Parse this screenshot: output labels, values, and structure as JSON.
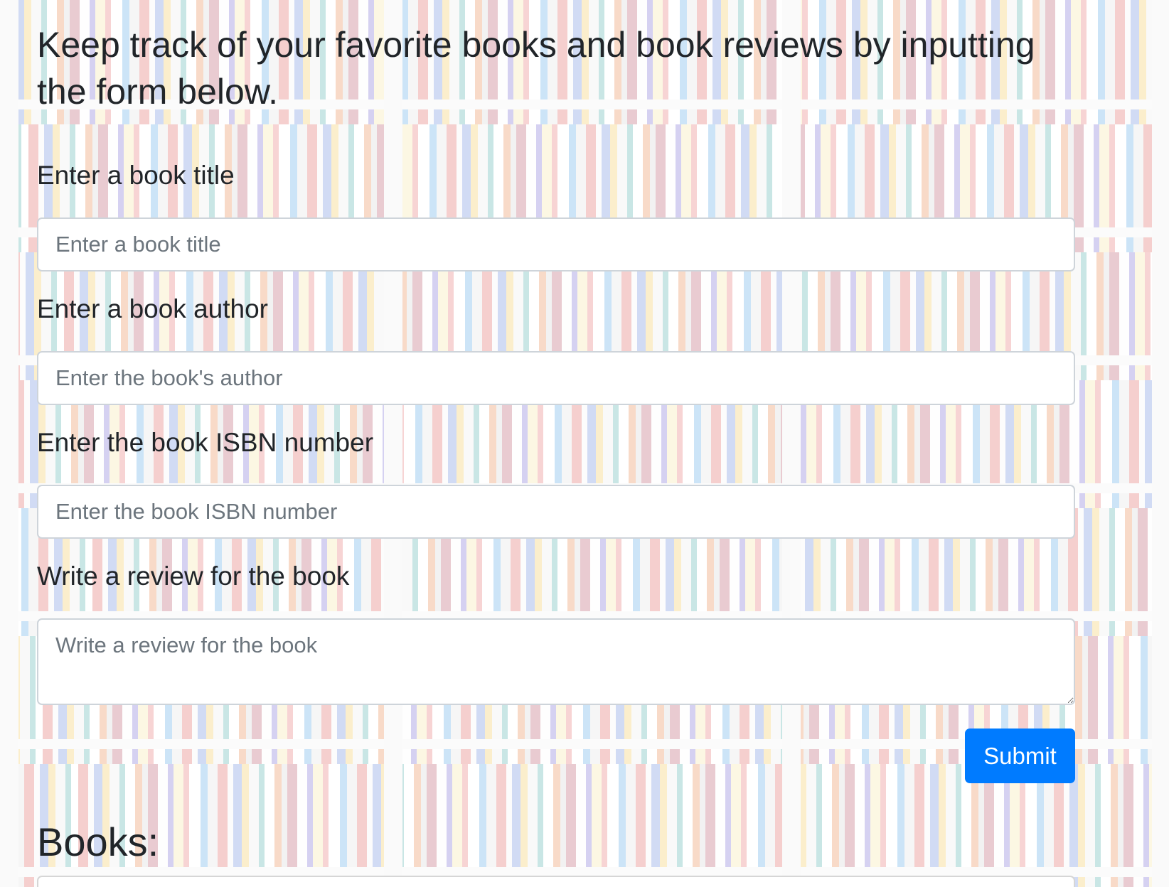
{
  "intro": {
    "text": "Keep track of your favorite books and book reviews by inputting the form below."
  },
  "form": {
    "title": {
      "label": "Enter a book title",
      "placeholder": "Enter a book title",
      "value": ""
    },
    "author": {
      "label": "Enter a book author",
      "placeholder": "Enter the book's author",
      "value": ""
    },
    "isbn": {
      "label": "Enter the book ISBN number",
      "placeholder": "Enter the book ISBN number",
      "value": ""
    },
    "review": {
      "label": "Write a review for the book",
      "placeholder": "Write a review for the book",
      "value": ""
    },
    "submit_label": "Submit"
  },
  "books": {
    "heading": "Books:"
  },
  "colors": {
    "primary": "#007bff",
    "text": "#212529",
    "placeholder": "#6c757d",
    "input_border": "#ced4da"
  }
}
